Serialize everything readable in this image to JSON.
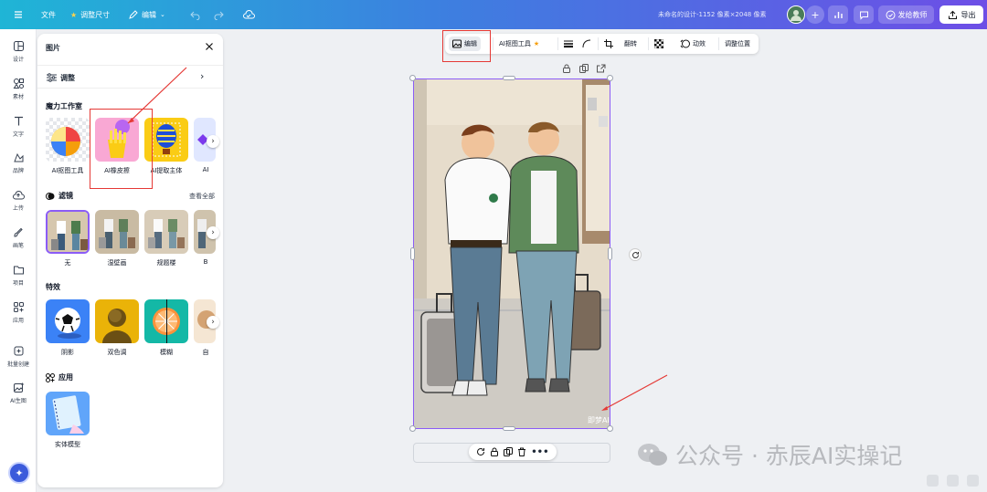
{
  "topbar": {
    "menu_icon": "menu-icon",
    "file_label": "文件",
    "resize_label": "调整尺寸",
    "edit_label": "编辑",
    "design_title": "未命名的设计-1152 像素×2048 像素",
    "share_label": "发给教师",
    "export_label": "导出"
  },
  "rail": {
    "items": [
      {
        "label": "设计",
        "icon": "layout-icon"
      },
      {
        "label": "素材",
        "icon": "shapes-icon"
      },
      {
        "label": "文字",
        "icon": "text-icon"
      },
      {
        "label": "品牌",
        "icon": "brand-icon"
      },
      {
        "label": "上传",
        "icon": "upload-icon"
      },
      {
        "label": "画笔",
        "icon": "brush-icon"
      },
      {
        "label": "项目",
        "icon": "folder-icon"
      },
      {
        "label": "应用",
        "icon": "apps-icon"
      },
      {
        "label": "批量创建",
        "icon": "batch-icon"
      },
      {
        "label": "AI生图",
        "icon": "ai-image-icon"
      }
    ]
  },
  "panel": {
    "title": "图片",
    "adjust_label": "调整",
    "magic_studio": {
      "title": "魔力工作室",
      "items": [
        {
          "label": "AI抠图工具"
        },
        {
          "label": "AI橡皮擦"
        },
        {
          "label": "AI提取主体"
        },
        {
          "label": "AI"
        }
      ]
    },
    "filters": {
      "title": "滤镜",
      "view_all": "查看全部",
      "items": [
        {
          "label": "无"
        },
        {
          "label": "湿壁画"
        },
        {
          "label": "规题楼"
        },
        {
          "label": "B"
        }
      ]
    },
    "effects": {
      "title": "特效",
      "items": [
        {
          "label": "阴影"
        },
        {
          "label": "双色调"
        },
        {
          "label": "模糊"
        },
        {
          "label": "自"
        }
      ]
    },
    "apps": {
      "title": "应用",
      "items": [
        {
          "label": "实体模型"
        }
      ]
    }
  },
  "toolbar": {
    "edit_label": "编辑",
    "ai_tool_label": "AI抠图工具",
    "flip_label": "翻转",
    "animate_label": "动效",
    "position_label": "调整位置"
  },
  "canvas": {
    "image_watermark": "即梦AI"
  },
  "watermark": {
    "text": "公众号 · 赤辰AI实操记"
  },
  "colors": {
    "accent": "#8b5cf6",
    "topbar_start": "#1fb5d6",
    "topbar_end": "#6d4ee6",
    "annotation_red": "#e53935"
  }
}
